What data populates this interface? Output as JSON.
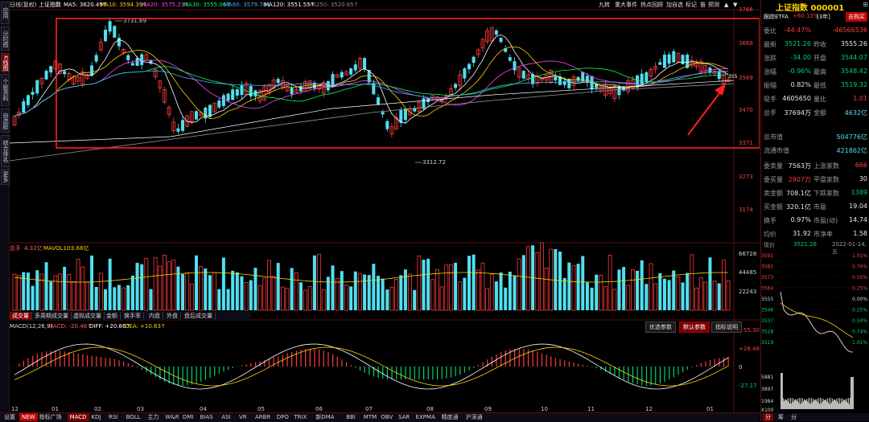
{
  "left_rail": [
    "应用",
    "分时图",
    "K线图",
    "个股资料",
    "自选股",
    "综合排名",
    "更多"
  ],
  "topbar": {
    "period": "日线(复权)",
    "name": "上证指数",
    "ma5": "MA5: 3620.49↑",
    "ma10": "MA10: 3594.39↑",
    "ma20": "MA20: 3575.23↑",
    "ma30": "MA30: 3555.06↑",
    "ma60": "MA60: 3579.78↓",
    "ma120": "MA120: 3551.55↑",
    "ma250": "MA250: 3520.65↑",
    "menu": [
      "九转",
      "重大事件",
      "热点回顾",
      "加自选",
      "标记",
      "笛",
      "预测"
    ]
  },
  "price_axis": [
    "3766",
    "3668",
    "3569",
    "3470",
    "3371",
    "3273",
    "3174"
  ],
  "annotations": {
    "high": "3731.69",
    "low": "3312.72",
    "last": "355"
  },
  "volume": {
    "header_label": "总手",
    "header_value": "4.32亿",
    "mavol_label": "MAVOL10:",
    "mavol_value": "3.66亿",
    "axis": [
      "66728",
      "44485",
      "22243"
    ],
    "tabs": [
      "成交量",
      "多周期成交量",
      "虚拟成交量",
      "金额",
      "换手率",
      "内盘",
      "外盘",
      "盘后成交量"
    ]
  },
  "macd": {
    "params": "MACD(12,26,9)",
    "macd_value": "MACD: -20.48↑",
    "diff_value": "DIFF: +20.86↑",
    "dea_value": "DEA: +10.63↑",
    "axis": [
      "+55.30",
      "+28.48",
      "0",
      "-27.17"
    ],
    "buttons": [
      "优选参数",
      "默认参数",
      "指标说明"
    ]
  },
  "month_axis": [
    "12",
    "01",
    "02",
    "03",
    "04",
    "05",
    "06",
    "07",
    "08",
    "09",
    "10",
    "11",
    "12",
    "01"
  ],
  "bottom_tabs": [
    "设置",
    "NEW",
    "指标广场",
    "MACD",
    "KDJ",
    "RSI",
    "BOLL",
    "主力",
    "W&R",
    "DMI",
    "BIAS",
    "ASI",
    "VR",
    "ARBR",
    "DPO",
    "TRIX",
    "新DMA",
    "BBI",
    "MTM",
    "OBV",
    "SAR",
    "EXPMA",
    "精度通",
    "沪深通"
  ],
  "right": {
    "title": "上证指数 000001",
    "etf_label": "跟踪ETFA",
    "etf_value": "+60.12%",
    "etf_suffix": "[3年]",
    "go_buy": "去购买",
    "quote_rows": [
      {
        "l1": "委比",
        "v1": "-44.47%",
        "c1": "red",
        "l2": "",
        "v2": "-46566536",
        "c2": "red"
      },
      {
        "l1": "最新",
        "v1": "3521.26",
        "c1": "green",
        "l2": "昨收",
        "v2": "3555.26",
        "c2": "white"
      },
      {
        "l1": "涨跌",
        "v1": "-34.00",
        "c1": "green",
        "l2": "开盘",
        "v2": "3544.07",
        "c2": "green"
      },
      {
        "l1": "涨幅",
        "v1": "-0.96%",
        "c1": "green",
        "l2": "最高",
        "v2": "3548.42",
        "c2": "green"
      },
      {
        "l1": "振幅",
        "v1": "0.82%",
        "c1": "white",
        "l2": "最低",
        "v2": "3519.32",
        "c2": "green"
      },
      {
        "l1": "现手",
        "v1": "4605650",
        "c1": "white",
        "l2": "量比",
        "v2": "1.01",
        "c2": "red"
      },
      {
        "l1": "总手",
        "v1": "37694万",
        "c1": "white",
        "l2": "金额",
        "v2": "4632亿",
        "c2": "cyan"
      }
    ],
    "cap_rows": [
      {
        "l": "总市值",
        "v": "504776亿"
      },
      {
        "l": "流通市值",
        "v": "421862亿"
      }
    ],
    "stat_rows": [
      {
        "l1": "委卖量",
        "v1": "7563万",
        "c1": "white",
        "l2": "上涨家数",
        "v2": "666",
        "c2": "red"
      },
      {
        "l1": "委买量",
        "v1": "2907万",
        "c1": "red",
        "l2": "平盘家数",
        "v2": "30",
        "c2": "white"
      },
      {
        "l1": "卖金额",
        "v1": "708.1亿",
        "c1": "white",
        "l2": "下跌家数",
        "v2": "1389",
        "c2": "green"
      },
      {
        "l1": "买金额",
        "v1": "320.1亿",
        "c1": "white",
        "l2": "市盈",
        "v2": "19.04",
        "c2": "white"
      },
      {
        "l1": "换手",
        "v1": "0.97%",
        "c1": "white",
        "l2": "市盈(动)",
        "v2": "14.74",
        "c2": "white"
      },
      {
        "l1": "均价",
        "v1": "31.92",
        "c1": "white",
        "l2": "市净率",
        "v2": "1.58",
        "c2": "white"
      }
    ],
    "mini": {
      "now_label": "现价",
      "now_value": "3521.26",
      "date": "2022-01-14,五",
      "left_axis": [
        "3591",
        "3582",
        "3573",
        "3564",
        "3555",
        "3546",
        "3537",
        "3528",
        "3519",
        "5881",
        "3897",
        "1984"
      ],
      "right_axis": [
        "1.01%",
        "0.76%",
        "0.50%",
        "0.25%",
        "0.00%",
        "0.25%",
        "0.50%",
        "0.74%",
        "1.01%"
      ],
      "vol_unit": "X100",
      "tabs": [
        "分",
        "筹",
        "分"
      ]
    }
  },
  "colors": {
    "up": "#ff3b3b",
    "down": "#4fe0f0",
    "box": "#ff2020",
    "arrow": "#ff2020"
  }
}
